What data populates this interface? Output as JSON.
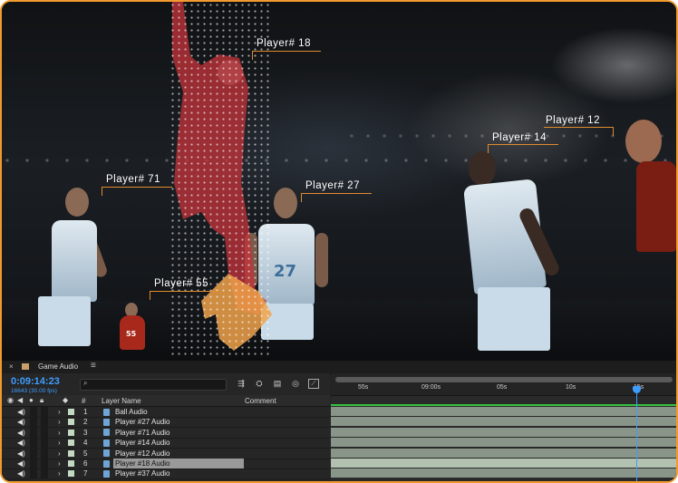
{
  "scene": {
    "labels": [
      {
        "key": "p18",
        "text": "Player# 18"
      },
      {
        "key": "p12",
        "text": "Player# 12"
      },
      {
        "key": "p14",
        "text": "Player# 14"
      },
      {
        "key": "p71",
        "text": "Player# 71"
      },
      {
        "key": "p27",
        "text": "Player# 27"
      },
      {
        "key": "p55",
        "text": "Player# 55"
      }
    ],
    "jersey_numbers": [
      "27",
      "55"
    ],
    "accent_color": "#e08a2e"
  },
  "panel": {
    "tab_title": "Game Audio",
    "timecode": "0:09:14:23",
    "timecode_sub": "16643 (30.00 fps)",
    "search_placeholder": "",
    "columns": {
      "hash": "#",
      "layer_name": "Layer Name",
      "comment": "Comment"
    },
    "layers": [
      {
        "num": "1",
        "name": "Ball Audio"
      },
      {
        "num": "2",
        "name": "Player #27 Audio"
      },
      {
        "num": "3",
        "name": "Player #71 Audio"
      },
      {
        "num": "4",
        "name": "Player #14 Audio"
      },
      {
        "num": "5",
        "name": "Player #12 Audio"
      },
      {
        "num": "6",
        "name": "Player #18 Audio",
        "selected": true
      },
      {
        "num": "7",
        "name": "Player #37 Audio"
      }
    ],
    "ruler_ticks": [
      "55s",
      "09:00s",
      "05s",
      "10s",
      "15s"
    ],
    "timecode_color": "#3e9dff",
    "selected_color": "#9a9a9a"
  }
}
